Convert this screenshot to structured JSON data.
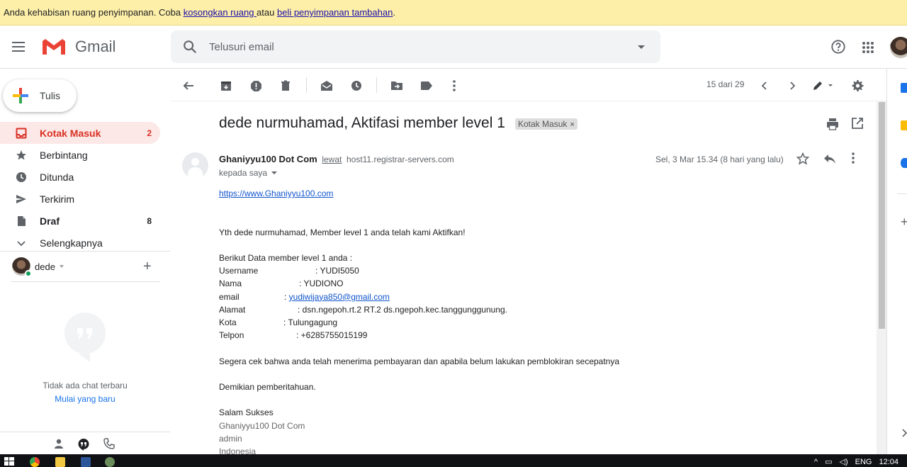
{
  "banner": {
    "text_before": "Anda kehabisan ruang penyimpanan. Coba ",
    "link1": "kosongkan ruang ",
    "text_mid": "atau ",
    "link2": "beli penyimpanan tambahan",
    "text_after": "."
  },
  "header": {
    "app_name": "Gmail",
    "search_placeholder": "Telusuri email"
  },
  "compose": {
    "label": "Tulis"
  },
  "nav": [
    {
      "label": "Kotak Masuk",
      "count": "2",
      "icon": "inbox-icon"
    },
    {
      "label": "Berbintang",
      "count": "",
      "icon": "star-icon"
    },
    {
      "label": "Ditunda",
      "count": "",
      "icon": "clock-icon"
    },
    {
      "label": "Terkirim",
      "count": "",
      "icon": "send-icon"
    },
    {
      "label": "Draf",
      "count": "8",
      "icon": "draft-icon"
    },
    {
      "label": "Selengkapnya",
      "count": "",
      "icon": "chevron-down-icon"
    }
  ],
  "hangouts": {
    "user": "dede",
    "empty_text": "Tidak ada chat terbaru",
    "start_link": "Mulai yang baru"
  },
  "toolbar": {
    "pager": "15 dari 29"
  },
  "message": {
    "subject": "dede nurmuhamad, Aktifasi member level 1",
    "label": "Kotak Masuk",
    "sender_name": "Ghaniyyu100 Dot Com",
    "via": "lewat",
    "host": "host11.registrar-servers.com",
    "to": "kepada saya",
    "date": "Sel, 3 Mar 15.34 (8 hari yang lalu)",
    "body": {
      "url": "https://www.Ghaniyyu100.com",
      "greeting": "Yth dede nurmuhamad, Member level 1 anda telah kami Aktifkan!",
      "intro": "Berikut Data member level 1 anda :",
      "username_label": "Username",
      "username_value": ": YUDI5050",
      "nama_label": "Nama",
      "nama_value": ": YUDIONO",
      "email_label": "email",
      "email_value": "yudiwijaya850@gmail.com",
      "alamat_label": "Alamat",
      "alamat_value": ": dsn.ngepoh.rt.2 RT.2 ds.ngepoh.kec.tanggunggunung.",
      "kota_label": "Kota",
      "kota_value": ": Tulungagung",
      "telpon_label": "Telpon",
      "telpon_value": ": +6285755015199",
      "check": "Segera cek bahwa anda telah menerima pembayaran dan apabila belum lakukan pemblokiran secepatnya",
      "closing": "Demikian pemberitahuan.",
      "salam": "Salam Sukses",
      "sig1": "Ghaniyyu100 Dot Com",
      "sig2": "admin",
      "sig3": "Indonesia"
    }
  },
  "taskbar": {
    "lang": "ENG",
    "time": "12:04"
  },
  "colors": {
    "accent": "#d93025",
    "link": "#1155cc",
    "banner": "#fdefa8",
    "active_nav_bg": "#fce8e6"
  }
}
